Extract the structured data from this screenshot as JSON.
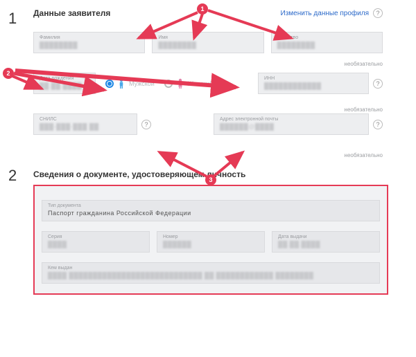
{
  "callouts": {
    "c1": "1",
    "c2": "2",
    "c3": "3"
  },
  "section1": {
    "step": "1",
    "title": "Данные заявителя",
    "edit_link": "Изменить данные профиля",
    "optional": "необязательно",
    "fields": {
      "surname": {
        "label": "Фамилия",
        "value": "████████"
      },
      "name": {
        "label": "Имя",
        "value": "████████"
      },
      "patronymic": {
        "label": "Отчество",
        "value": "████████"
      },
      "dob": {
        "label": "Дата рождения",
        "value": "██.██.████"
      },
      "gender_m": "Мужской",
      "gender_f": "Женский",
      "inn": {
        "label": "ИНН",
        "value": "████████████"
      },
      "snils": {
        "label": "СНИЛС",
        "value": "███-███-███ ██"
      },
      "email": {
        "label": "Адрес электронной почты",
        "value": "██████@████"
      }
    }
  },
  "section2": {
    "step": "2",
    "title": "Сведения о документе, удостоверяющем личность",
    "doc_type": {
      "label": "Тип документа",
      "value": "Паспорт гражданина Российской Федерации"
    },
    "series": {
      "label": "Серия",
      "value": "████"
    },
    "number": {
      "label": "Номер",
      "value": "██████"
    },
    "issue_date": {
      "label": "Дата выдачи",
      "value": "██.██.████"
    },
    "issued_by": {
      "label": "Кем выдан",
      "value": "████ ████████████████████████████ ██ ████████████ ████████"
    }
  },
  "help": "?"
}
